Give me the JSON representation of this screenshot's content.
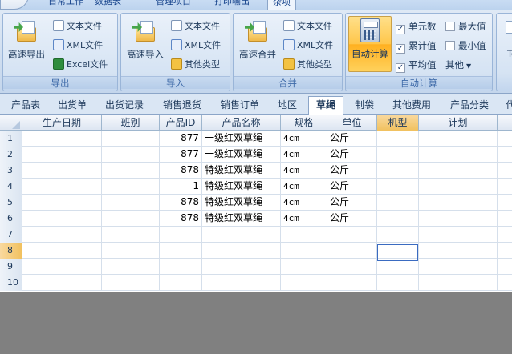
{
  "menu": {
    "tabs": [
      {
        "label": "日常工作",
        "active": false
      },
      {
        "label": "数据表",
        "active": false
      },
      {
        "label": "管理项目",
        "active": false
      },
      {
        "label": "打印输出",
        "active": false
      },
      {
        "label": "杂项",
        "active": true
      }
    ]
  },
  "ribbon": {
    "export": {
      "label": "导出",
      "big": "高速导出",
      "small": [
        "文本文件",
        "XML文件",
        "Excel文件"
      ]
    },
    "import": {
      "label": "导入",
      "big": "高速导入",
      "small": [
        "文本文件",
        "XML文件",
        "其他类型"
      ]
    },
    "merge": {
      "label": "合并",
      "big": "高速合并",
      "small": [
        "文本文件",
        "XML文件",
        "其他类型"
      ]
    },
    "autocalc": {
      "label": "自动计算",
      "big": "自动计算",
      "checks": [
        {
          "label": "单元数",
          "checked": true
        },
        {
          "label": "最大值",
          "checked": false
        },
        {
          "label": "累计值",
          "checked": true
        },
        {
          "label": "最小值",
          "checked": false
        },
        {
          "label": "平均值",
          "checked": true
        }
      ],
      "other": "其他"
    },
    "cut_label": "To"
  },
  "sheet_tabs": [
    {
      "label": "产品表",
      "active": false
    },
    {
      "label": "出货单",
      "active": false
    },
    {
      "label": "出货记录",
      "active": false
    },
    {
      "label": "销售退货",
      "active": false
    },
    {
      "label": "销售订单",
      "active": false
    },
    {
      "label": "地区",
      "active": false
    },
    {
      "label": "草绳",
      "active": true
    },
    {
      "label": "制袋",
      "active": false
    },
    {
      "label": "其他费用",
      "active": false
    },
    {
      "label": "产品分类",
      "active": false
    },
    {
      "label": "代",
      "active": false
    }
  ],
  "grid": {
    "columns": [
      "生产日期",
      "班别",
      "产品ID",
      "产品名称",
      "规格",
      "单位",
      "机型",
      "计划"
    ],
    "selected_column": "机型",
    "rows": [
      {
        "n": "1",
        "date": "",
        "shift": "",
        "id": "877",
        "name": "一级红双草绳",
        "spec": "4cm",
        "unit": "公斤",
        "model": "",
        "plan": ""
      },
      {
        "n": "2",
        "date": "",
        "shift": "",
        "id": "877",
        "name": "一级红双草绳",
        "spec": "4cm",
        "unit": "公斤",
        "model": "",
        "plan": ""
      },
      {
        "n": "3",
        "date": "",
        "shift": "",
        "id": "878",
        "name": "特级红双草绳",
        "spec": "4cm",
        "unit": "公斤",
        "model": "",
        "plan": ""
      },
      {
        "n": "4",
        "date": "",
        "shift": "",
        "id": "1",
        "name": "特级红双草绳",
        "spec": "4cm",
        "unit": "公斤",
        "model": "",
        "plan": ""
      },
      {
        "n": "5",
        "date": "",
        "shift": "",
        "id": "878",
        "name": "特级红双草绳",
        "spec": "4cm",
        "unit": "公斤",
        "model": "",
        "plan": ""
      },
      {
        "n": "6",
        "date": "",
        "shift": "",
        "id": "878",
        "name": "特级红双草绳",
        "spec": "4cm",
        "unit": "公斤",
        "model": "",
        "plan": ""
      },
      {
        "n": "7",
        "date": "",
        "shift": "",
        "id": "",
        "name": "",
        "spec": "",
        "unit": "",
        "model": "",
        "plan": ""
      },
      {
        "n": "8",
        "date": "",
        "shift": "",
        "id": "",
        "name": "",
        "spec": "",
        "unit": "",
        "model": "",
        "plan": ""
      },
      {
        "n": "9",
        "date": "",
        "shift": "",
        "id": "",
        "name": "",
        "spec": "",
        "unit": "",
        "model": "",
        "plan": ""
      },
      {
        "n": "10",
        "date": "",
        "shift": "",
        "id": "",
        "name": "",
        "spec": "",
        "unit": "",
        "model": "",
        "plan": ""
      }
    ],
    "selected_row": "8"
  }
}
